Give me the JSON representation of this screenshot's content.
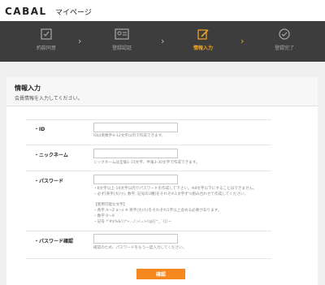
{
  "header": {
    "logo": "CABAL",
    "mypage": "マイページ"
  },
  "steps": [
    {
      "label": "約款同意",
      "icon": "checklist-icon",
      "active": false
    },
    {
      "label": "登録認証",
      "icon": "id-card-icon",
      "active": false
    },
    {
      "label": "情報入力",
      "icon": "edit-icon",
      "active": true
    },
    {
      "label": "登録完了",
      "icon": "check-circle-icon",
      "active": false
    }
  ],
  "colors": {
    "accent": "#f5a623",
    "button": "#f5891f",
    "bar": "#3d3d3d"
  },
  "panel": {
    "title": "情報入力",
    "subtitle": "会員情報を入力してください。"
  },
  "fields": {
    "id": {
      "label": "・ID",
      "value": "",
      "note": "IDは英数字4-12文字以内で作成できます。"
    },
    "nickname": {
      "label": "・ニックネーム",
      "value": "",
      "note": "ニックネームは全角1-15文字、半角3-30文字で作成できます。"
    },
    "password": {
      "label": "・パスワード",
      "value": "",
      "notes": [
        "・8文字以上-16文字以内でパスワードを作成して下さい。※8文字以下にすることはできません。",
        "・必ず[英字(大/小), 数字, 記号の3種]をそれぞれ1文字ずつ組み合わせて作成してください。",
        "【使用可能な文字】",
        "・英字  A～Z a～z ※ 英字(大/小)をそれぞれ1字以上含める必要があります。",
        "・数字  0～9",
        "・記号  !\"#$%&'()*+,-./:;<=>?@[]^_`{|}~"
      ]
    },
    "password_confirm": {
      "label": "・パスワード確認",
      "value": "",
      "note": "確認のため、パスワードをもう一度入力してください。"
    }
  },
  "submit_label": "確認"
}
